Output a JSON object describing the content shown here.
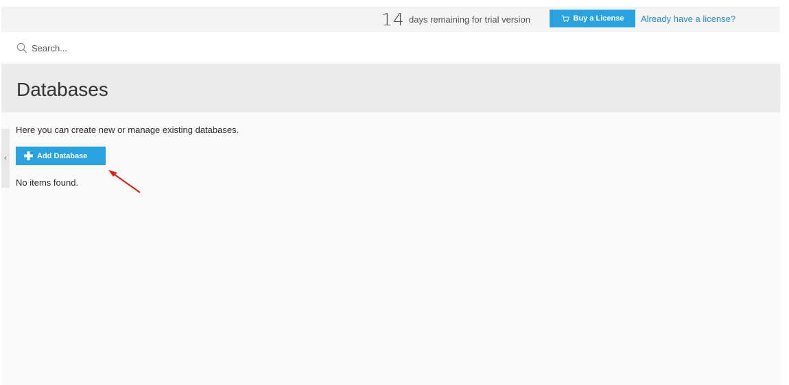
{
  "trial": {
    "days": "14",
    "text": "days remaining for trial version",
    "buy_label": "Buy a License",
    "have_license_label": "Already have a license?"
  },
  "search": {
    "placeholder": "Search..."
  },
  "page": {
    "title": "Databases",
    "description": "Here you can create new or manage existing databases.",
    "add_button_label": "Add Database",
    "empty_message": "No items found."
  },
  "sidebar": {
    "collapse_glyph": "‹"
  },
  "colors": {
    "accent": "#28a3e0",
    "link": "#1f8ed2",
    "annotation_arrow": "#e0201b"
  },
  "icons": {
    "cart": "cart-icon",
    "search": "search-icon",
    "plus": "plus-icon",
    "collapse": "chevron-left-icon"
  }
}
